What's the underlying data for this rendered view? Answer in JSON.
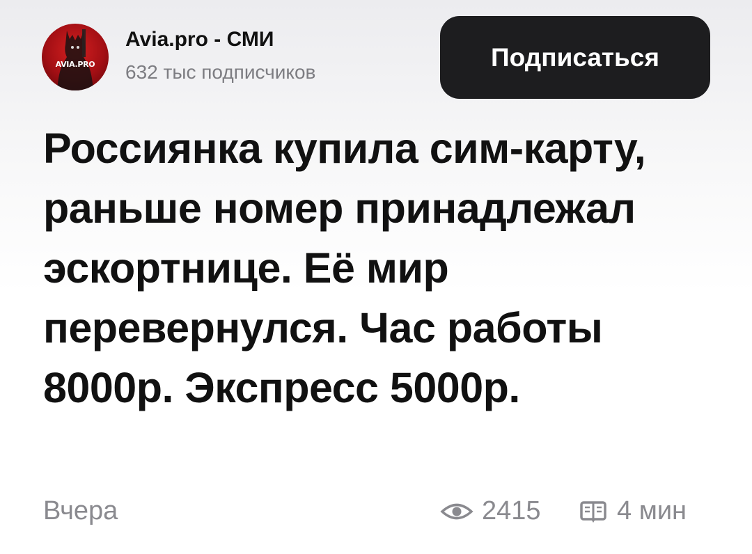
{
  "channel": {
    "name": "Avia.pro - СМИ",
    "subscribers": "632 тыс подписчиков",
    "avatar_text": "AVIA.PRO",
    "avatar_color": "#b01218"
  },
  "subscribe_button": {
    "label": "Подписаться",
    "background": "#1d1d1f"
  },
  "article": {
    "title": "Россиянка купила сим-карту, раньше номер принадлежал эскортнице. Её мир перевернулся. Час работы 8000р. Экспресс 5000р."
  },
  "footer": {
    "date": "Вчера",
    "views": "2415",
    "views_icon": "eye-icon",
    "read_time": "4 мин",
    "read_time_icon": "book-icon"
  }
}
